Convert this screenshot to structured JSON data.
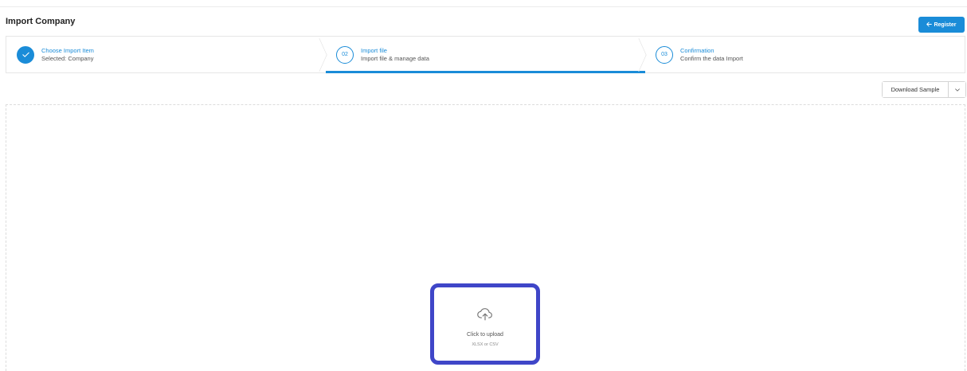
{
  "header": {
    "title": "Import Company",
    "register_label": "Register",
    "accent_color": "#1a8cd8"
  },
  "stepper": {
    "steps": [
      {
        "number": "✓",
        "title": "Choose Import Item",
        "subtitle": "Selected: Company",
        "state": "done"
      },
      {
        "number": "02",
        "title": "Import file",
        "subtitle": "Import file & manage data",
        "state": "active"
      },
      {
        "number": "03",
        "title": "Confirmation",
        "subtitle": "Confirm the data Import",
        "state": "pending"
      }
    ]
  },
  "toolbar": {
    "download_label": "Download Sample",
    "download_toggle_icon": "chevron-down-icon"
  },
  "upload": {
    "icon": "cloud-upload-icon",
    "label": "Click to upload",
    "hint": "XLSX or CSV",
    "highlight_color": "#3f46c8"
  }
}
